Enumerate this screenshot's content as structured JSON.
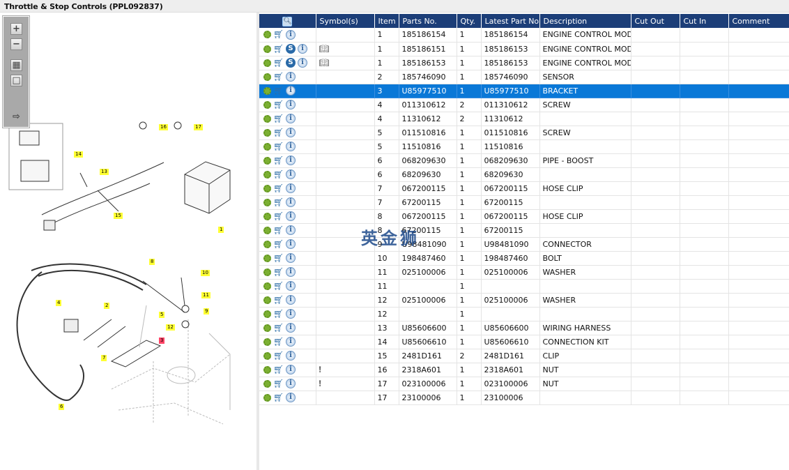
{
  "title": "Throttle & Stop Controls (PPL092837)",
  "toolbar": {
    "buttons": [
      {
        "name": "zoom-in",
        "glyph": "+"
      },
      {
        "name": "zoom-out",
        "glyph": "−"
      },
      {
        "name": "fit-all",
        "glyph": "▦"
      },
      {
        "name": "actual-size",
        "glyph": "□"
      },
      {
        "name": "toggle-list",
        "glyph": "⇨"
      }
    ]
  },
  "diagram": {
    "callouts": [
      "1",
      "2",
      "3",
      "4",
      "5",
      "6",
      "7",
      "8",
      "9",
      "10",
      "11",
      "12",
      "13",
      "14",
      "15",
      "16",
      "17"
    ],
    "highlight_color": "#ff4466"
  },
  "table": {
    "columns": [
      "",
      "Symbol(s)",
      "Item",
      "Parts No.",
      "Qty.",
      "Latest Part No.",
      "Description",
      "Cut Out",
      "Cut In",
      "Comment"
    ],
    "selected_color": "#0a78d7",
    "header_color": "#1c3e78",
    "rows": [
      {
        "s": false,
        "sym": false,
        "item": "1",
        "part": "185186154",
        "qty": "1",
        "latest": "185186154",
        "desc": "ENGINE CONTROL MODULE"
      },
      {
        "s": true,
        "sym": "book-search",
        "item": "1",
        "part": "185186151",
        "qty": "1",
        "latest": "185186153",
        "desc": "ENGINE CONTROL MODULE"
      },
      {
        "s": true,
        "sym": "book-search",
        "item": "1",
        "part": "185186153",
        "qty": "1",
        "latest": "185186153",
        "desc": "ENGINE CONTROL MODULE"
      },
      {
        "s": false,
        "sym": false,
        "item": "2",
        "part": "185746090",
        "qty": "1",
        "latest": "185746090",
        "desc": "SENSOR"
      },
      {
        "s": false,
        "sym": false,
        "item": "3",
        "part": "U85977510",
        "qty": "1",
        "latest": "U85977510",
        "desc": "BRACKET",
        "selected": true
      },
      {
        "s": false,
        "sym": false,
        "item": "4",
        "part": "011310612",
        "qty": "2",
        "latest": "011310612",
        "desc": "SCREW"
      },
      {
        "s": false,
        "sym": false,
        "item": "4",
        "part": "11310612",
        "qty": "2",
        "latest": "11310612",
        "desc": ""
      },
      {
        "s": false,
        "sym": false,
        "item": "5",
        "part": "011510816",
        "qty": "1",
        "latest": "011510816",
        "desc": "SCREW"
      },
      {
        "s": false,
        "sym": false,
        "item": "5",
        "part": "11510816",
        "qty": "1",
        "latest": "11510816",
        "desc": ""
      },
      {
        "s": false,
        "sym": false,
        "item": "6",
        "part": "068209630",
        "qty": "1",
        "latest": "068209630",
        "desc": "PIPE - BOOST"
      },
      {
        "s": false,
        "sym": false,
        "item": "6",
        "part": "68209630",
        "qty": "1",
        "latest": "68209630",
        "desc": ""
      },
      {
        "s": false,
        "sym": false,
        "item": "7",
        "part": "067200115",
        "qty": "1",
        "latest": "067200115",
        "desc": "HOSE CLIP"
      },
      {
        "s": false,
        "sym": false,
        "item": "7",
        "part": "67200115",
        "qty": "1",
        "latest": "67200115",
        "desc": ""
      },
      {
        "s": false,
        "sym": false,
        "item": "8",
        "part": "067200115",
        "qty": "1",
        "latest": "067200115",
        "desc": "HOSE CLIP"
      },
      {
        "s": false,
        "sym": false,
        "item": "8",
        "part": "67200115",
        "qty": "1",
        "latest": "67200115",
        "desc": ""
      },
      {
        "s": false,
        "sym": false,
        "item": "9",
        "part": "U98481090",
        "qty": "1",
        "latest": "U98481090",
        "desc": "CONNECTOR"
      },
      {
        "s": false,
        "sym": false,
        "item": "10",
        "part": "198487460",
        "qty": "1",
        "latest": "198487460",
        "desc": "BOLT"
      },
      {
        "s": false,
        "sym": false,
        "item": "11",
        "part": "025100006",
        "qty": "1",
        "latest": "025100006",
        "desc": "WASHER"
      },
      {
        "s": false,
        "sym": false,
        "item": "11",
        "part": "",
        "qty": "1",
        "latest": "",
        "desc": ""
      },
      {
        "s": false,
        "sym": false,
        "item": "12",
        "part": "025100006",
        "qty": "1",
        "latest": "025100006",
        "desc": "WASHER"
      },
      {
        "s": false,
        "sym": false,
        "item": "12",
        "part": "",
        "qty": "1",
        "latest": "",
        "desc": ""
      },
      {
        "s": false,
        "sym": false,
        "item": "13",
        "part": "U85606600",
        "qty": "1",
        "latest": "U85606600",
        "desc": "WIRING HARNESS"
      },
      {
        "s": false,
        "sym": false,
        "item": "14",
        "part": "U85606610",
        "qty": "1",
        "latest": "U85606610",
        "desc": "CONNECTION KIT"
      },
      {
        "s": false,
        "sym": false,
        "item": "15",
        "part": "2481D161",
        "qty": "2",
        "latest": "2481D161",
        "desc": "CLIP"
      },
      {
        "s": false,
        "sym": "note-pin",
        "item": "16",
        "part": "2318A601",
        "qty": "1",
        "latest": "2318A601",
        "desc": "NUT"
      },
      {
        "s": false,
        "sym": "note-pin",
        "item": "17",
        "part": "023100006",
        "qty": "1",
        "latest": "023100006",
        "desc": "NUT"
      },
      {
        "s": false,
        "sym": false,
        "item": "17",
        "part": "23100006",
        "qty": "1",
        "latest": "23100006",
        "desc": ""
      }
    ]
  },
  "watermark": "英金狮"
}
